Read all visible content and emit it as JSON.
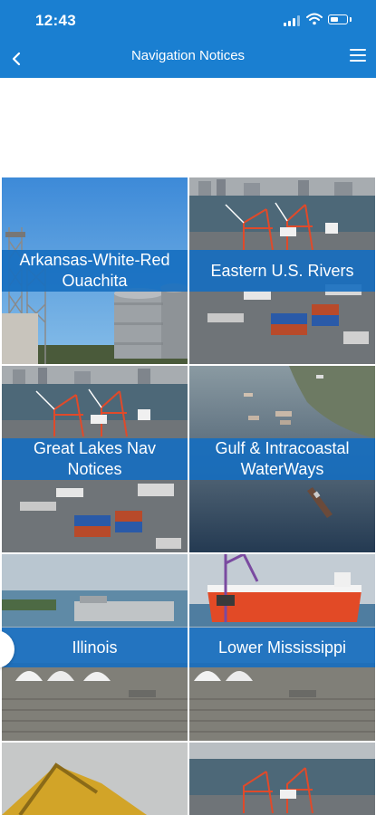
{
  "status": {
    "time": "12:43"
  },
  "navbar": {
    "title": "Navigation Notices",
    "back_icon": "chevron-left-icon",
    "menu_icon": "hamburger-menu-icon"
  },
  "colors": {
    "header": "#1a7fd1",
    "label_band": "#156ec0"
  },
  "tiles": [
    {
      "label": "Arkansas-White-Red Ouachita"
    },
    {
      "label": "Eastern U.S. Rivers"
    },
    {
      "label": "Great Lakes Nav Notices"
    },
    {
      "label": "Gulf & Intracoastal WaterWays"
    },
    {
      "label": "Illinois"
    },
    {
      "label": "Lower Mississippi"
    }
  ]
}
